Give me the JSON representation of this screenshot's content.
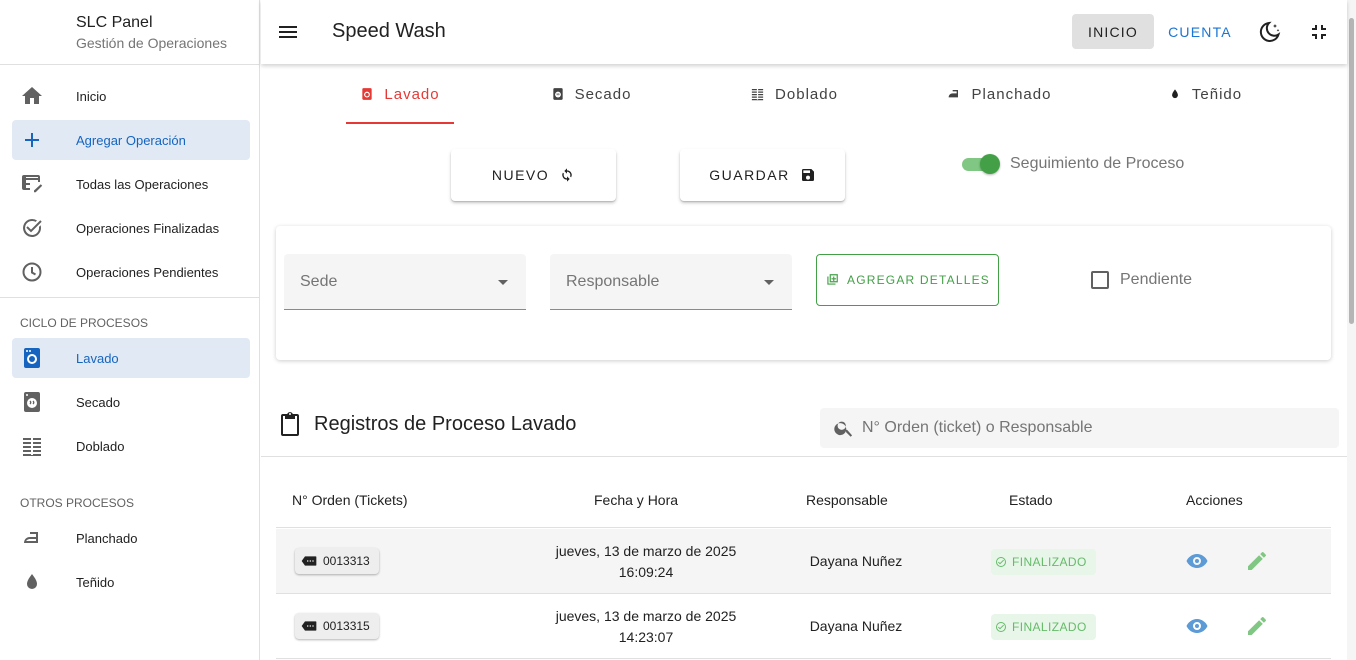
{
  "sidebar": {
    "brand_title": "SLC Panel",
    "brand_subtitle": "Gestión de Operaciones",
    "main_items": [
      {
        "label": "Inicio",
        "icon": "home-icon"
      },
      {
        "label": "Agregar Operación",
        "icon": "plus-icon",
        "active": true
      },
      {
        "label": "Todas las Operaciones",
        "icon": "table-edit-icon"
      },
      {
        "label": "Operaciones Finalizadas",
        "icon": "check-circle-icon"
      },
      {
        "label": "Operaciones Pendientes",
        "icon": "clock-icon"
      }
    ],
    "section_cycle": "CICLO DE PROCESOS",
    "cycle_items": [
      {
        "label": "Lavado",
        "icon": "washing-machine-icon",
        "active": true
      },
      {
        "label": "Secado",
        "icon": "dryer-icon"
      },
      {
        "label": "Doblado",
        "icon": "fold-icon"
      }
    ],
    "section_other": "OTROS PROCESOS",
    "other_items": [
      {
        "label": "Planchado",
        "icon": "iron-icon"
      },
      {
        "label": "Teñido",
        "icon": "drop-icon"
      }
    ]
  },
  "header": {
    "title": "Speed Wash",
    "inicio": "INICIO",
    "cuenta": "CUENTA"
  },
  "tabs": [
    {
      "label": "Lavado",
      "active": true
    },
    {
      "label": "Secado"
    },
    {
      "label": "Doblado"
    },
    {
      "label": "Planchado"
    },
    {
      "label": "Teñido"
    }
  ],
  "actions": {
    "nuevo": "NUEVO",
    "guardar": "GUARDAR",
    "tracking_label": "Seguimiento de Proceso",
    "tracking_on": true
  },
  "form": {
    "sede_placeholder": "Sede",
    "responsable_placeholder": "Responsable",
    "add_details": "AGREGAR DETALLES",
    "pendiente_label": "Pendiente"
  },
  "records": {
    "title": "Registros de Proceso Lavado",
    "search_placeholder": "N° Orden (ticket) o Responsable",
    "columns": [
      "N° Orden (Tickets)",
      "Fecha y Hora",
      "Responsable",
      "Estado",
      "Acciones"
    ],
    "rows": [
      {
        "ticket": "0013313",
        "date": "jueves, 13 de marzo de 2025",
        "time": "16:09:24",
        "responsable": "Dayana Nuñez",
        "estado": "FINALIZADO"
      },
      {
        "ticket": "0013315",
        "date": "jueves, 13 de marzo de 2025",
        "time": "14:23:07",
        "responsable": "Dayana Nuñez",
        "estado": "FINALIZADO"
      }
    ]
  },
  "colors": {
    "accent_blue": "#1976d2",
    "tab_active_red": "#e53935",
    "success_green": "#43a047"
  }
}
